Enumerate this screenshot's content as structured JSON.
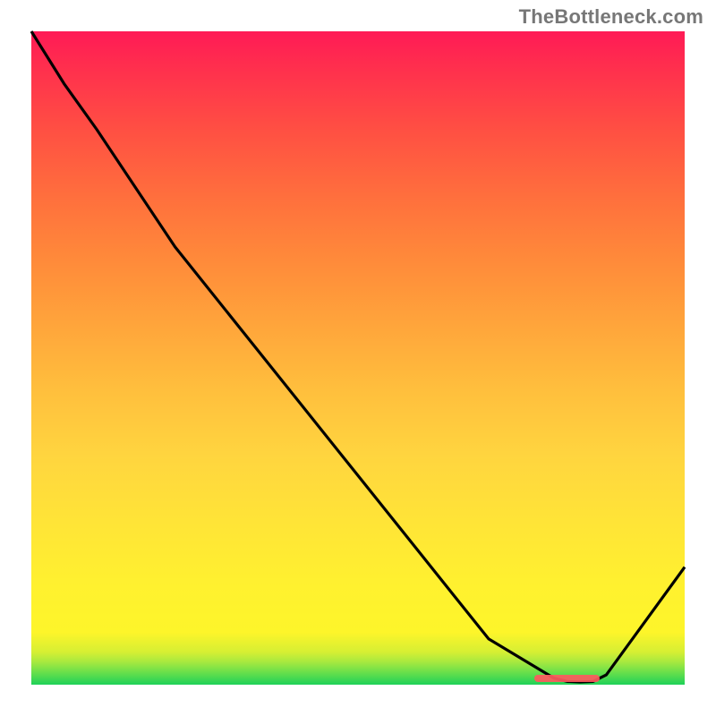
{
  "watermark": "TheBottleneck.com",
  "chart_data": {
    "type": "line",
    "title": "",
    "xlabel": "",
    "ylabel": "",
    "xlim": [
      0,
      100
    ],
    "ylim": [
      0,
      100
    ],
    "categories": [
      0,
      5,
      10,
      15,
      20,
      22,
      30,
      40,
      50,
      60,
      70,
      80,
      82,
      84,
      86,
      88,
      100
    ],
    "values": [
      100,
      92,
      85,
      77.5,
      70,
      67,
      57,
      44.5,
      32,
      19.5,
      7,
      1,
      0.5,
      0.4,
      0.5,
      1.5,
      18
    ],
    "annotations": [
      {
        "text": "",
        "x_from": 77,
        "x_to": 87,
        "y": 1.0,
        "style": "optimum-marker"
      }
    ]
  }
}
